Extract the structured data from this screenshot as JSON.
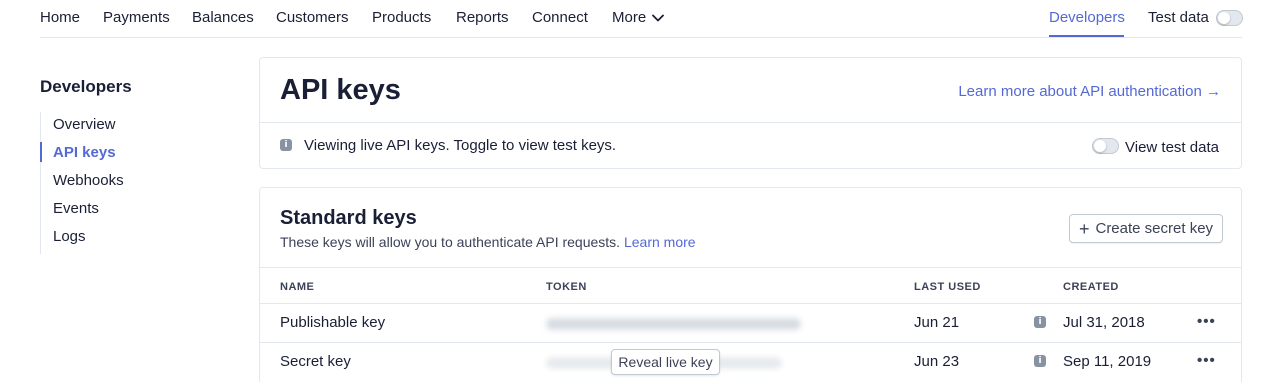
{
  "nav": {
    "items": [
      "Home",
      "Payments",
      "Balances",
      "Customers",
      "Products",
      "Reports",
      "Connect"
    ],
    "more": "More",
    "developers": "Developers",
    "test_data": "Test data"
  },
  "sidebar": {
    "title": "Developers",
    "items": [
      "Overview",
      "API keys",
      "Webhooks",
      "Events",
      "Logs"
    ],
    "active": "API keys"
  },
  "api_card": {
    "title": "API keys",
    "learn_link": "Learn more about API authentication →",
    "notice": "Viewing live API keys. Toggle to view test keys.",
    "view_test": "View test data"
  },
  "standard": {
    "title": "Standard keys",
    "description": "These keys will allow you to authenticate API requests.",
    "learn_more": "Learn more",
    "create_button": "Create secret key",
    "columns": [
      "NAME",
      "TOKEN",
      "LAST USED",
      "CREATED"
    ],
    "rows": [
      {
        "name": "Publishable key",
        "last_used": "Jun 21",
        "created": "Jul 31, 2018"
      },
      {
        "name": "Secret key",
        "last_used": "Jun 23",
        "created": "Sep 11, 2019"
      }
    ],
    "reveal_button": "Reveal live key",
    "more_actions": "•••"
  },
  "colors": {
    "accent": "#5469d4",
    "text": "#1a1f36",
    "border": "#e3e8ee"
  }
}
